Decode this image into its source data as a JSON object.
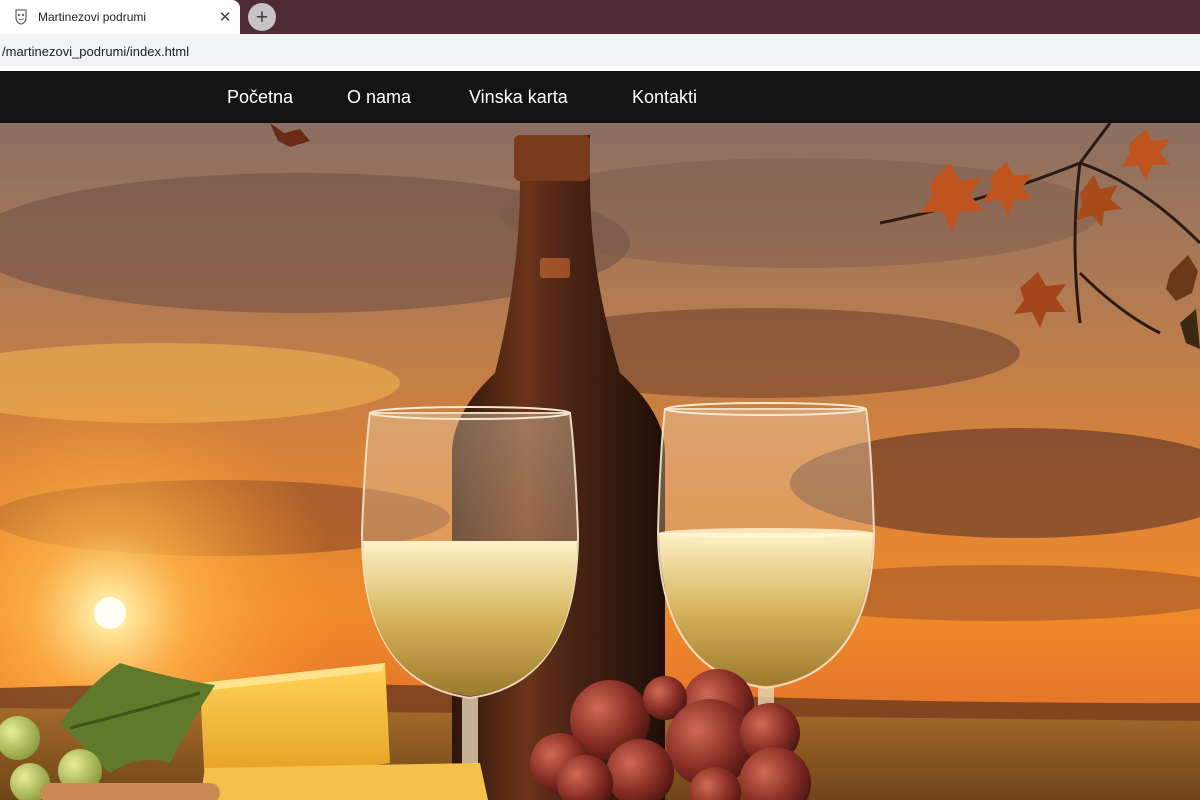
{
  "browser": {
    "tab_title": "Martinezovi podrumi",
    "tab_icon": "wine-cellar-favicon-icon",
    "close_icon": "close-icon",
    "new_tab_icon": "plus-icon",
    "url": "/martinezovi_podrumi/index.html",
    "colors": {
      "tabstrip": "#4f2b36",
      "addressbar": "#f1f3f4"
    }
  },
  "nav": {
    "items": [
      {
        "label": "Početna"
      },
      {
        "label": "O nama"
      },
      {
        "label": "Vinska karta"
      },
      {
        "label": "Kontakti"
      }
    ],
    "colors": {
      "background": "#141414",
      "text": "#ffffff"
    }
  },
  "hero": {
    "image": "hero-image",
    "colors": {
      "sky_top": "#8a6f63",
      "sun_glow": "#ffd27a",
      "wine": "#d6b45c",
      "bottle": "#4a2414",
      "grapes": "#8a2f26"
    }
  }
}
